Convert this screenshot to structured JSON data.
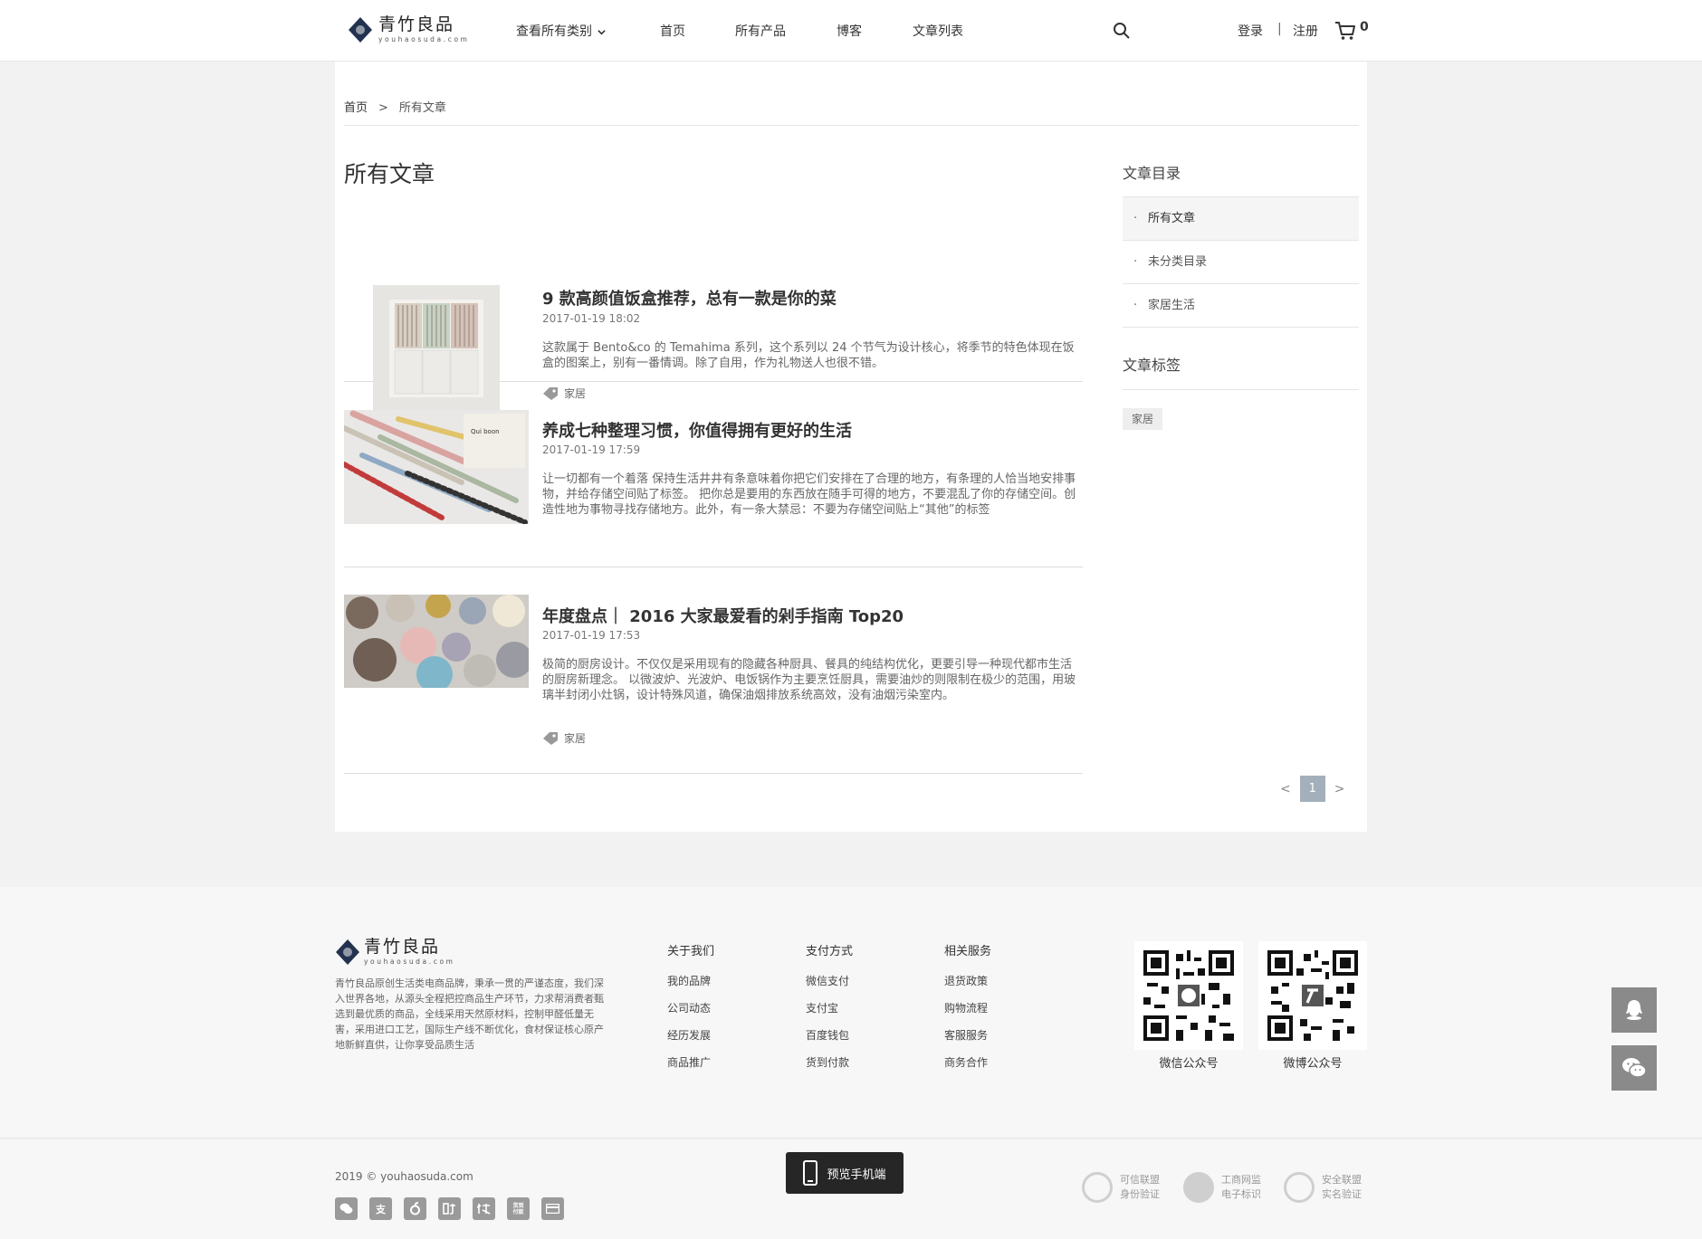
{
  "header": {
    "logo_cn": "青竹良品",
    "logo_en": "youhaosuda.com",
    "nav": [
      "查看所有类别",
      "首页",
      "所有产品",
      "博客",
      "文章列表"
    ],
    "login": "登录",
    "separator": "|",
    "register": "注册",
    "cart_count": "0"
  },
  "breadcrumb": {
    "home": "首页",
    "arrow": ">",
    "current": "所有文章"
  },
  "page_title": "所有文章",
  "articles": [
    {
      "title": "9 款高颜值饭盒推荐，总有一款是你的菜",
      "date": "2017-01-19 18:02",
      "desc": "这款属于 Bento&co 的 Temahima 系列，这个系列以 24 个节气为设计核心，将季节的特色体现在饭盒的图案上，别有一番情调。除了自用，作为礼物送人也很不错。",
      "tag": "家居"
    },
    {
      "title": "养成七种整理习惯，你值得拥有更好的生活",
      "date": "2017-01-19 17:59",
      "desc": "让一切都有一个着落 保持生活井井有条意味着你把它们安排在了合理的地方，有条理的人恰当地安排事物，并给存储空间贴了标签。 把你总是要用的东西放在随手可得的地方，不要混乱了你的存储空间。创造性地为事物寻找存储地方。此外，有一条大禁忌：不要为存储空间贴上“其他”的标签",
      "thumb_text": "Qui boon"
    },
    {
      "title": "年度盘点｜ 2016 大家最爱看的剁手指南 Top20",
      "date": "2017-01-19 17:53",
      "desc": "极简的厨房设计。不仅仅是采用现有的隐藏各种厨具、餐具的纯结构优化，更要引导一种现代都市生活的厨房新理念。 以微波炉、光波炉、电饭锅作为主要烹饪厨具，需要油炒的则限制在极少的范围，用玻璃半封闭小灶锅，设计特殊风道，确保油烟排放系统高效，没有油烟污染室内。",
      "tag": "家居"
    }
  ],
  "sidebar": {
    "catalog_title": "文章目录",
    "catalog": [
      "所有文章",
      "未分类目录",
      "家居生活"
    ],
    "tags_title": "文章标签",
    "tags": [
      "家居"
    ]
  },
  "pager": {
    "prev": "<",
    "current": "1",
    "next": ">"
  },
  "footer": {
    "about": "青竹良品原创生活类电商品牌，秉承一贯的严谨态度，我们深入世界各地，从源头全程把控商品生产环节，力求帮消费者甄选到最优质的商品，全线采用天然原材料，控制甲醛低量无害，采用进口工艺，国际生产线不断优化，食材保证核心原产地新鲜直供，让你享受品质生活",
    "columns": [
      {
        "heading": "关于我们",
        "items": [
          "我的品牌",
          "公司动态",
          "经历发展",
          "商品推广"
        ]
      },
      {
        "heading": "支付方式",
        "items": [
          "微信支付",
          "支付宝",
          "百度钱包",
          "货到付款"
        ]
      },
      {
        "heading": "相关服务",
        "items": [
          "退货政策",
          "购物流程",
          "客服服务",
          "商务合作"
        ]
      }
    ],
    "qr": [
      "微信公众号",
      "微博公众号"
    ]
  },
  "bottom": {
    "copyright": "2019 © youhaosuda.com",
    "pay_icons": [
      "支",
      "货到\n付款"
    ],
    "preview": "预览手机端",
    "certs": [
      {
        "line1": "可信联盟",
        "line2": "身份验证"
      },
      {
        "line1": "工商网监",
        "line2": "电子标识"
      },
      {
        "line1": "安全联盟",
        "line2": "实名验证"
      }
    ]
  },
  "colors": {
    "accent": "#a3b0bb",
    "dark": "#262626",
    "float": "#8a8a8a"
  }
}
